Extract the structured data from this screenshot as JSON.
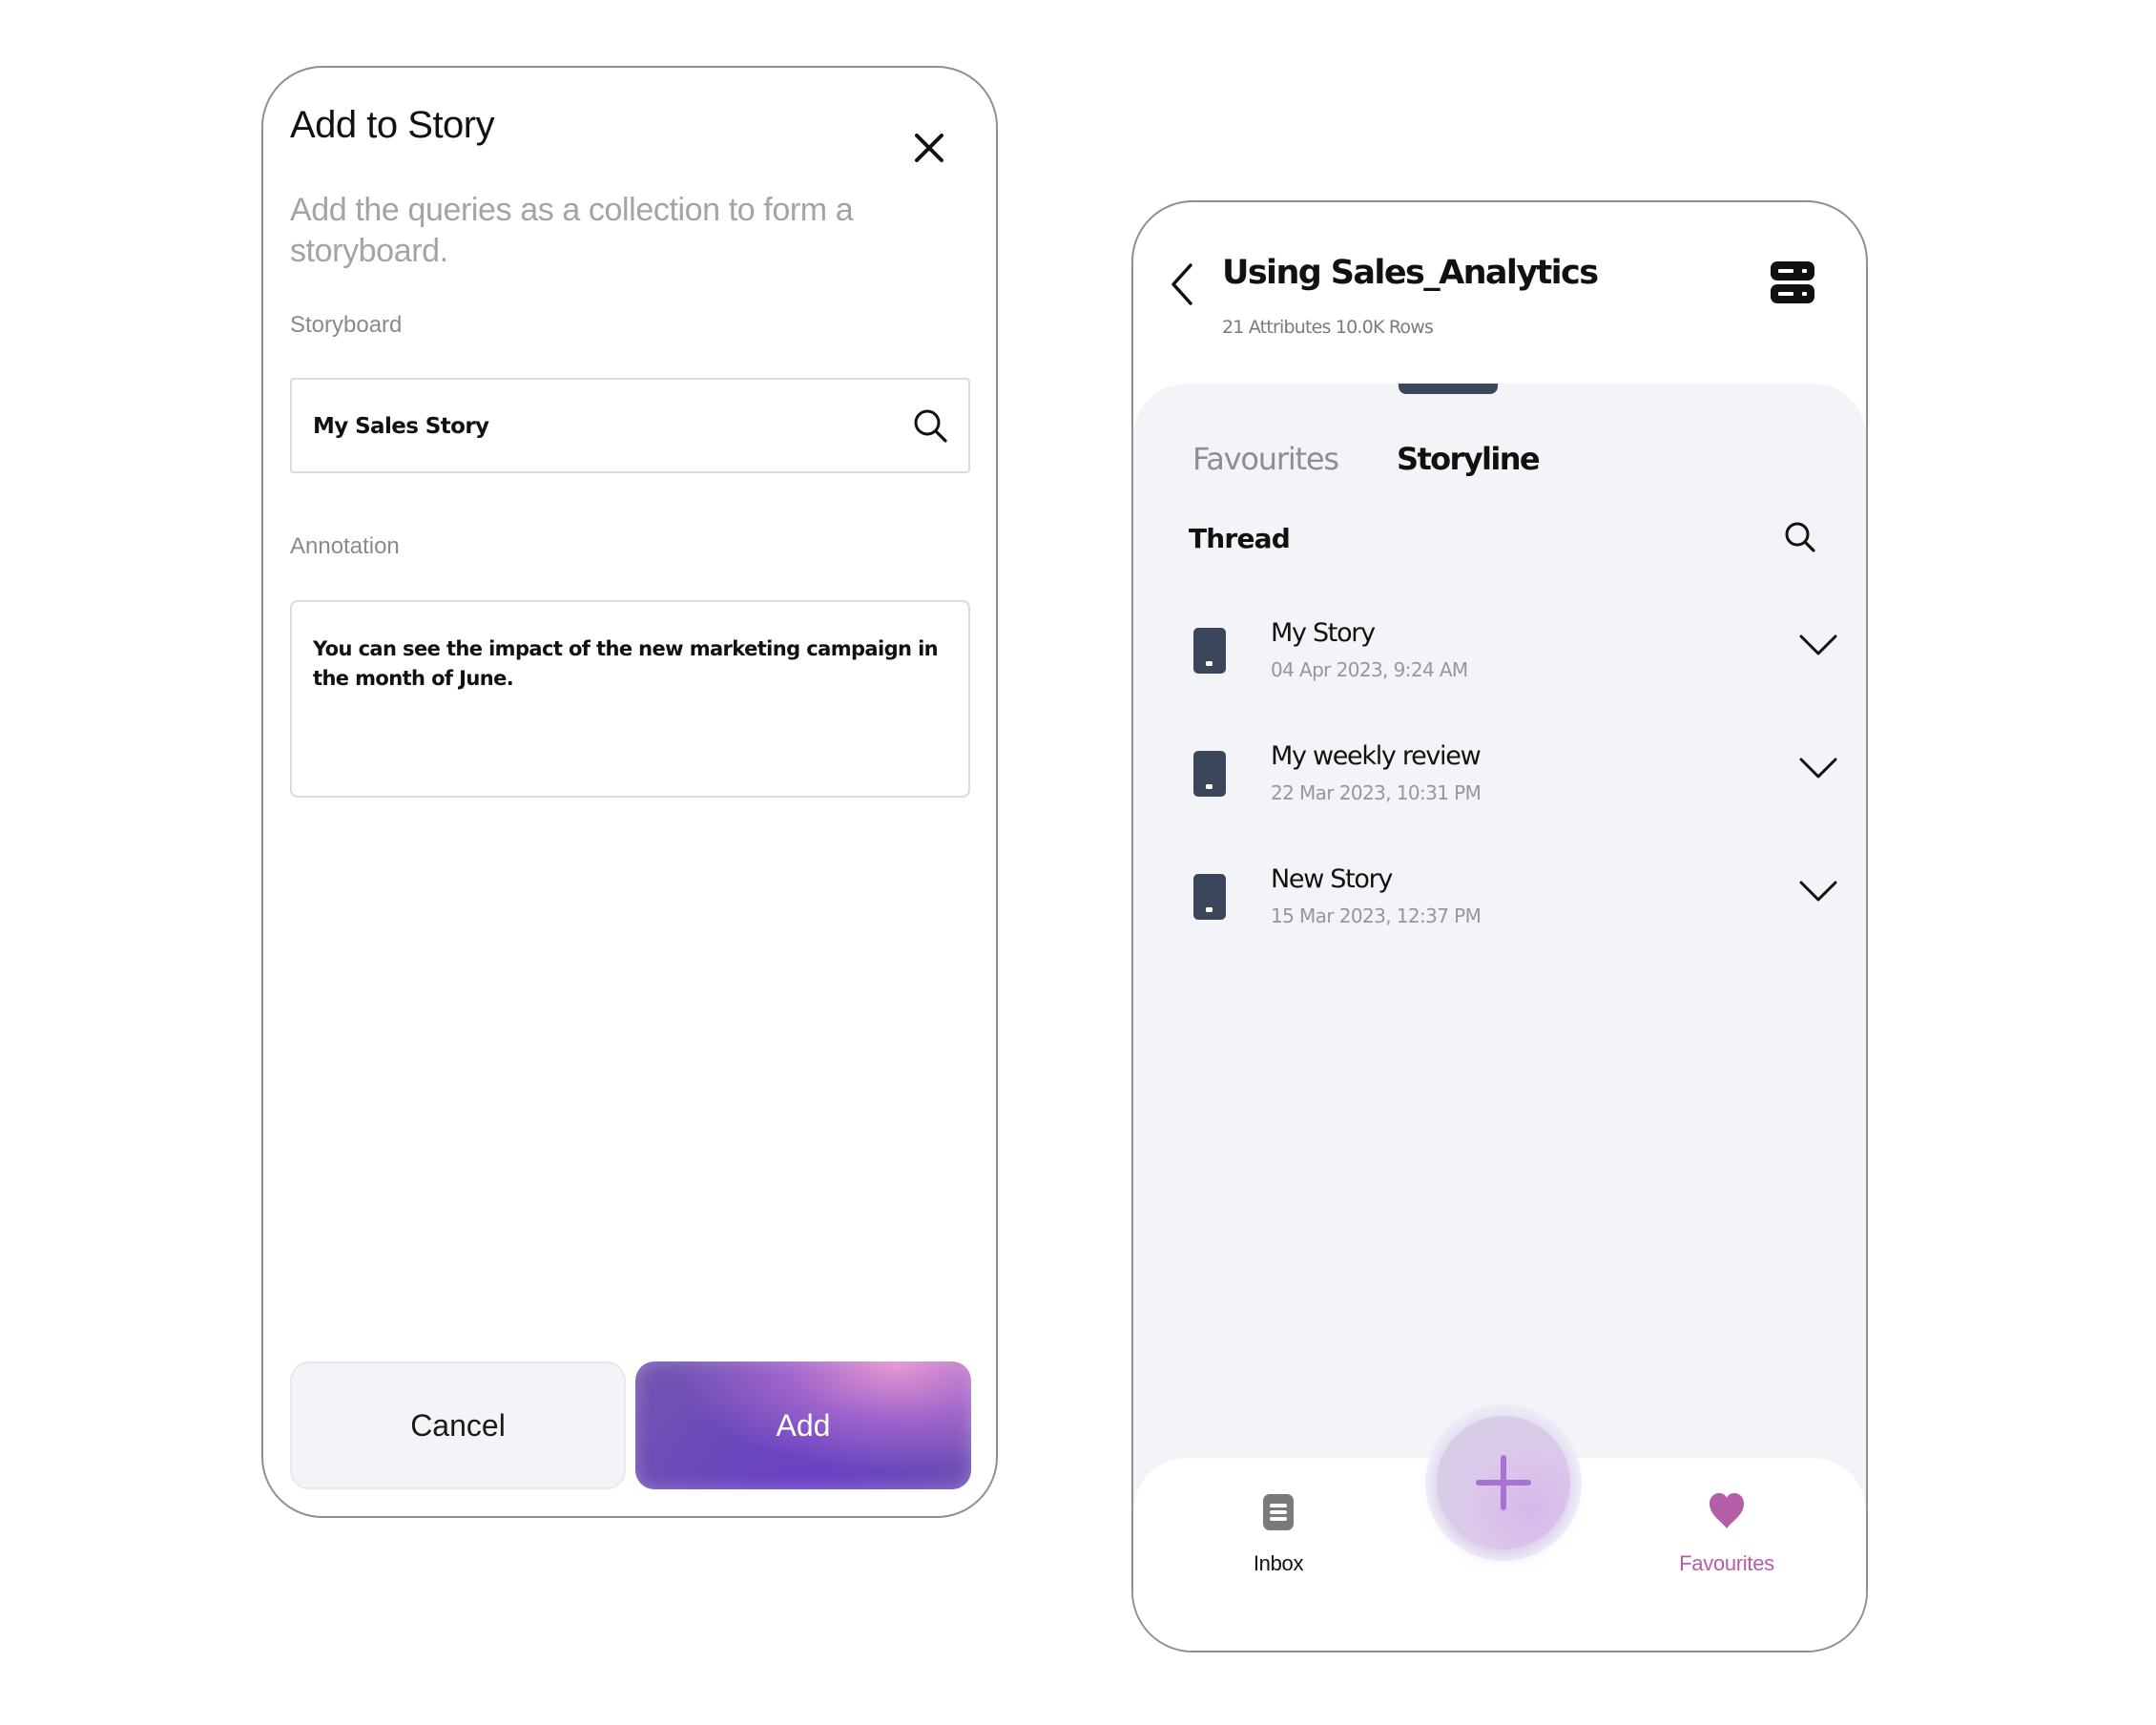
{
  "add_to_story_dialog": {
    "title": "Add to Story",
    "close_icon": "close-icon",
    "subtitle": "Add the queries as a collection to form a storyboard.",
    "storyboard": {
      "label": "Storyboard",
      "value": "My Sales Story",
      "icon": "search-icon"
    },
    "annotation": {
      "label": "Annotation",
      "value": "You can see the impact of the new marketing campaign in the month of June."
    },
    "buttons": {
      "cancel": "Cancel",
      "add": "Add"
    },
    "colors": {
      "add_button": "#6b45c4",
      "cancel_button": "#f3f4f7"
    }
  },
  "storyline_screen": {
    "header": {
      "back_icon": "chevron-left-icon",
      "title": "Using Sales_Analytics",
      "subtitle": "21 Attributes 10.0K Rows",
      "action_icon": "database-icon"
    },
    "tabs": [
      {
        "label": "Favourites",
        "active": false
      },
      {
        "label": "Storyline",
        "active": true
      }
    ],
    "section": {
      "title": "Thread",
      "icon": "search-icon"
    },
    "stories": [
      {
        "title": "My Story",
        "date": "04 Apr 2023,  9:24 AM"
      },
      {
        "title": "My weekly review",
        "date": "22 Mar 2023,  10:31 PM"
      },
      {
        "title": "New Story",
        "date": "15 Mar 2023,  12:37 PM"
      }
    ],
    "bottom_nav": {
      "items": [
        {
          "label": "Inbox",
          "icon": "inbox-icon",
          "active": false
        },
        {
          "label": "Favourites",
          "icon": "heart-icon",
          "active": true
        }
      ],
      "fab_icon": "plus-icon"
    },
    "colors": {
      "accent": "#b45ea8",
      "fab_plus": "#a672d4",
      "sheet_background": "#f3f4f8",
      "icon_dark": "#3b465c"
    }
  }
}
